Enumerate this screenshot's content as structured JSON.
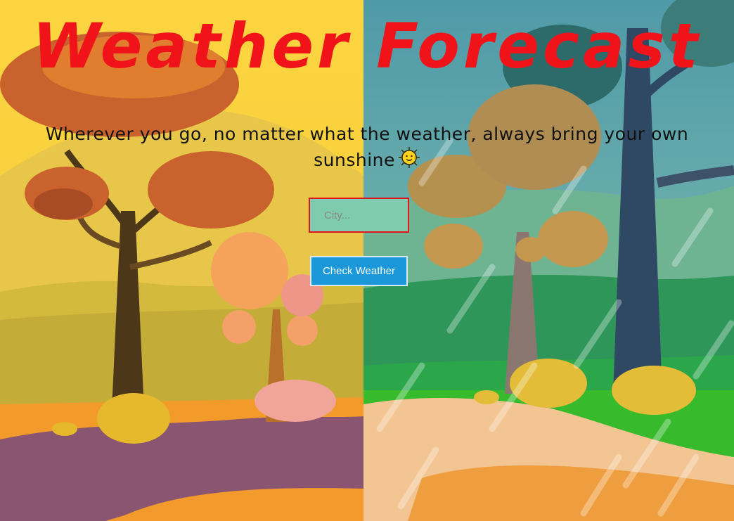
{
  "header": {
    "title": "Weather Forecast",
    "tagline": "Wherever you go, no matter what the weather, always bring your own sunshine"
  },
  "search": {
    "placeholder": "City...",
    "button_label": "Check Weather"
  },
  "colors": {
    "title": "#f0141a",
    "button": "#1a98d9",
    "input_border": "#e0161c"
  },
  "icons": {
    "tagline_icon": "sun-icon"
  }
}
